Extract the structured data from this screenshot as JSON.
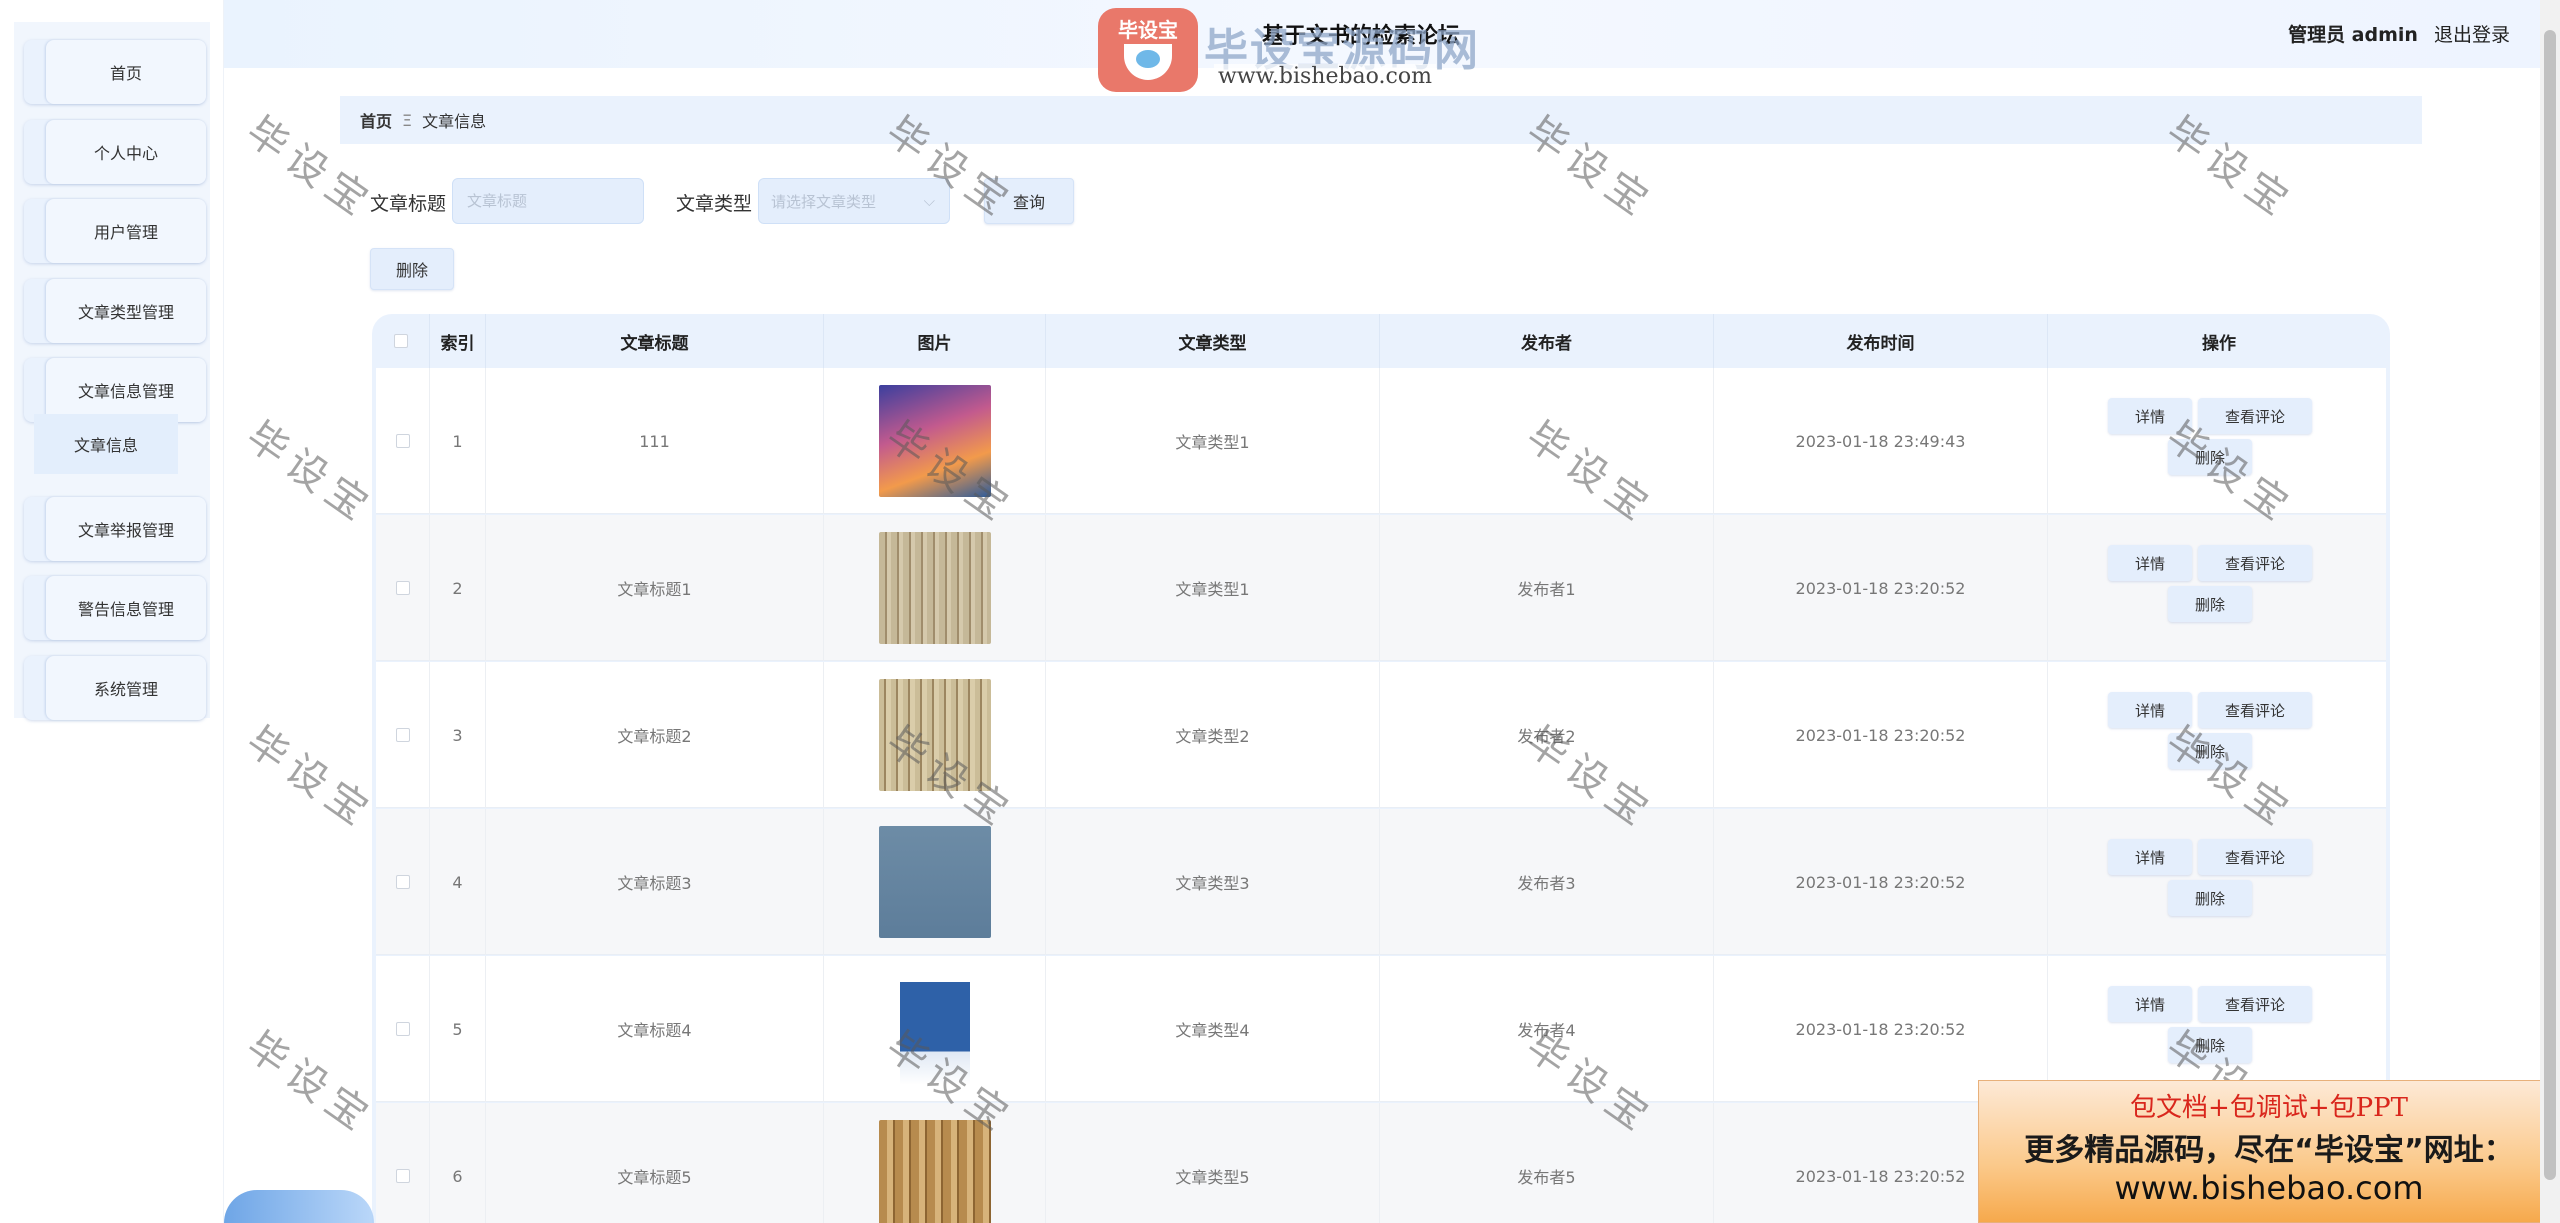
{
  "header": {
    "site_title": "基于文书的检索论坛",
    "role": "管理员 admin",
    "logout": "退出登录",
    "logo_badge": "毕设宝",
    "logo_text": "毕设宝源码网",
    "logo_url": "www.bishebao.com"
  },
  "sidebar": {
    "items": [
      {
        "label": "首页"
      },
      {
        "label": "个人中心"
      },
      {
        "label": "用户管理"
      },
      {
        "label": "文章类型管理"
      },
      {
        "label": "文章信息管理"
      },
      {
        "label": "文章举报管理"
      },
      {
        "label": "警告信息管理"
      },
      {
        "label": "系统管理"
      }
    ],
    "submenu": {
      "label": "文章信息"
    }
  },
  "breadcrumb": {
    "home": "首页",
    "sep": "Ξ",
    "current": "文章信息"
  },
  "search": {
    "title_label": "文章标题",
    "title_placeholder": "文章标题",
    "type_label": "文章类型",
    "type_placeholder": "请选择文章类型",
    "query_button": "查询",
    "delete_button": "删除"
  },
  "table": {
    "headers": [
      "",
      "索引",
      "文章标题",
      "图片",
      "文章类型",
      "发布者",
      "发布时间",
      "操作"
    ],
    "ops": {
      "detail": "详情",
      "comments": "查看评论",
      "delete": "删除"
    },
    "rows": [
      {
        "index": "1",
        "title": "111",
        "type": "文章类型1",
        "author": "",
        "time": "2023-01-18 23:49:43"
      },
      {
        "index": "2",
        "title": "文章标题1",
        "type": "文章类型1",
        "author": "发布者1",
        "time": "2023-01-18 23:20:52"
      },
      {
        "index": "3",
        "title": "文章标题2",
        "type": "文章类型2",
        "author": "发布者2",
        "time": "2023-01-18 23:20:52"
      },
      {
        "index": "4",
        "title": "文章标题3",
        "type": "文章类型3",
        "author": "发布者3",
        "time": "2023-01-18 23:20:52"
      },
      {
        "index": "5",
        "title": "文章标题4",
        "type": "文章类型4",
        "author": "发布者4",
        "time": "2023-01-18 23:20:52"
      },
      {
        "index": "6",
        "title": "文章标题5",
        "type": "文章类型5",
        "author": "发布者5",
        "time": "2023-01-18 23:20:52"
      }
    ]
  },
  "watermark": "毕设宝",
  "ad": {
    "line1": "包文档+包调试+包PPT",
    "line2": "更多精品源码，尽在“毕设宝”网址：",
    "line3": "www.bishebao.com"
  }
}
